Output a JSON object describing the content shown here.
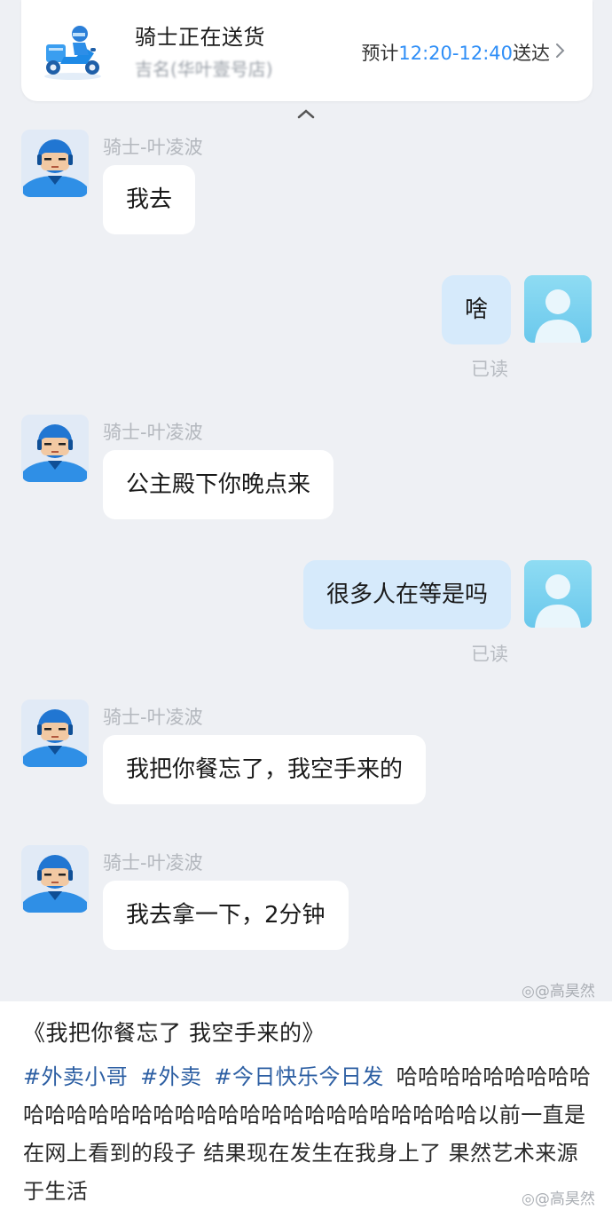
{
  "delivery": {
    "title": "骑士正在送货",
    "subtitle": "吉名(华叶壹号店)",
    "eta_prefix": "预计",
    "eta_time": "12:20-12:40",
    "eta_suffix": "送达"
  },
  "messages": [
    {
      "from": "rider",
      "sender": "骑士-叶凌波",
      "text": "我去"
    },
    {
      "from": "me",
      "text": "啥",
      "status": "已读"
    },
    {
      "from": "rider",
      "sender": "骑士-叶凌波",
      "text": "公主殿下你晚点来"
    },
    {
      "from": "me",
      "text": "很多人在等是吗",
      "status": "已读"
    },
    {
      "from": "rider",
      "sender": "骑士-叶凌波",
      "text": "我把你餐忘了，我空手来的"
    },
    {
      "from": "rider",
      "sender": "骑士-叶凌波",
      "text": "我去拿一下，2分钟"
    }
  ],
  "watermark": "@高昊然",
  "post": {
    "title": "《我把你餐忘了 我空手来的》",
    "tags": [
      "#外卖小哥",
      "#外卖",
      "#今日快乐今日发"
    ],
    "body": "哈哈哈哈哈哈哈哈哈哈哈哈哈哈哈哈哈哈哈哈哈哈哈哈哈哈哈哈哈哈以前一直是在网上看到的段子 结果现在发生在我身上了 果然艺术来源于生活"
  },
  "colors": {
    "accent": "#2e8ef7",
    "bubble_out": "#d6eafb",
    "bubble_in": "#ffffff",
    "background": "#eef0f4",
    "tag": "#2d5fa3"
  }
}
